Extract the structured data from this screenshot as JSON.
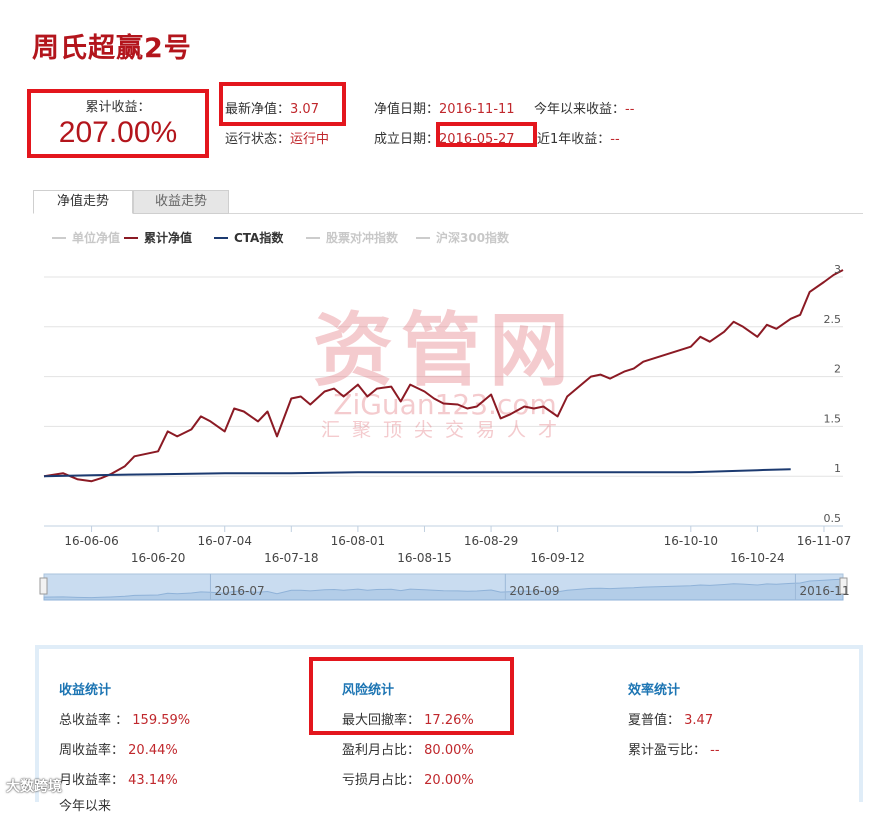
{
  "page": {
    "title": "周氏超赢2号"
  },
  "summary": {
    "cum_return_label": "累计收益：",
    "cum_return_value": "207.00%",
    "latest_nav_label": "最新净值：",
    "latest_nav_value": "3.07",
    "nav_date_label": "净值日期：",
    "nav_date_value": "2016-11-11",
    "ytd_label": "今年以来收益：",
    "ytd_value": "--",
    "status_label": "运行状态：",
    "status_value": "运行中",
    "inception_label": "成立日期：",
    "inception_value": "2016-05-27",
    "one_year_label": "近1年收益：",
    "one_year_value": "--"
  },
  "tabs": [
    {
      "label": "净值走势",
      "active": true
    },
    {
      "label": "收益走势",
      "active": false
    }
  ],
  "legend": [
    {
      "label": "单位净值",
      "color": "#cccccc",
      "enabled": false
    },
    {
      "label": "累计净值",
      "color": "#8b1a24",
      "enabled": true
    },
    {
      "label": "CTA指数",
      "color": "#1c3a70",
      "enabled": true
    },
    {
      "label": "股票对冲指数",
      "color": "#cccccc",
      "enabled": false
    },
    {
      "label": "沪深300指数",
      "color": "#cccccc",
      "enabled": false
    }
  ],
  "watermark": {
    "main": "资管网",
    "domain": "ZiGuan123.com",
    "slogan": "汇聚顶尖交易人才"
  },
  "navigator": {
    "labels": [
      "2016-07",
      "2016-09",
      "2016-11"
    ]
  },
  "chart_data": {
    "type": "line",
    "title": "",
    "xlabel": "",
    "ylabel": "",
    "ylim": [
      0.5,
      3.0
    ],
    "yticks": [
      "0.5",
      "1",
      "1.5",
      "2",
      "2.5",
      "3"
    ],
    "xticks": [
      "16-06-06",
      "16-06-20",
      "16-07-04",
      "16-07-18",
      "16-08-01",
      "16-08-15",
      "16-08-29",
      "16-09-12",
      "16-10-10",
      "16-10-24",
      "16-11-07"
    ],
    "grid": true,
    "legend_position": "top-left",
    "series": [
      {
        "name": "累计净值",
        "color": "#8b1a24",
        "x": [
          "2016-05-27",
          "2016-05-31",
          "2016-06-03",
          "2016-06-06",
          "2016-06-08",
          "2016-06-10",
          "2016-06-13",
          "2016-06-15",
          "2016-06-17",
          "2016-06-20",
          "2016-06-22",
          "2016-06-24",
          "2016-06-27",
          "2016-06-29",
          "2016-07-01",
          "2016-07-04",
          "2016-07-06",
          "2016-07-08",
          "2016-07-11",
          "2016-07-13",
          "2016-07-15",
          "2016-07-18",
          "2016-07-20",
          "2016-07-22",
          "2016-07-25",
          "2016-07-27",
          "2016-07-29",
          "2016-08-01",
          "2016-08-03",
          "2016-08-05",
          "2016-08-08",
          "2016-08-10",
          "2016-08-12",
          "2016-08-15",
          "2016-08-17",
          "2016-08-19",
          "2016-08-22",
          "2016-08-24",
          "2016-08-26",
          "2016-08-29",
          "2016-08-31",
          "2016-09-02",
          "2016-09-05",
          "2016-09-07",
          "2016-09-09",
          "2016-09-12",
          "2016-09-14",
          "2016-09-19",
          "2016-09-21",
          "2016-09-23",
          "2016-09-26",
          "2016-09-28",
          "2016-09-30",
          "2016-10-10",
          "2016-10-12",
          "2016-10-14",
          "2016-10-17",
          "2016-10-19",
          "2016-10-21",
          "2016-10-24",
          "2016-10-26",
          "2016-10-28",
          "2016-10-31",
          "2016-11-02",
          "2016-11-04",
          "2016-11-07",
          "2016-11-09",
          "2016-11-11"
        ],
        "y": [
          1.0,
          1.03,
          0.97,
          0.95,
          0.98,
          1.02,
          1.1,
          1.2,
          1.22,
          1.25,
          1.45,
          1.4,
          1.47,
          1.6,
          1.55,
          1.45,
          1.68,
          1.65,
          1.55,
          1.65,
          1.4,
          1.78,
          1.8,
          1.72,
          1.85,
          1.88,
          1.8,
          1.92,
          1.8,
          1.88,
          1.9,
          1.75,
          1.92,
          1.85,
          1.78,
          1.73,
          1.72,
          1.68,
          1.7,
          1.82,
          1.58,
          1.62,
          1.7,
          1.68,
          1.7,
          1.6,
          1.8,
          2.0,
          2.02,
          1.98,
          2.05,
          2.08,
          2.15,
          2.3,
          2.4,
          2.35,
          2.45,
          2.55,
          2.5,
          2.4,
          2.52,
          2.48,
          2.58,
          2.62,
          2.85,
          2.95,
          3.02,
          3.07
        ]
      },
      {
        "name": "CTA指数",
        "color": "#1c3a70",
        "x": [
          "2016-05-27",
          "2016-06-06",
          "2016-06-20",
          "2016-07-04",
          "2016-07-18",
          "2016-08-01",
          "2016-08-15",
          "2016-08-29",
          "2016-09-12",
          "2016-09-26",
          "2016-10-10",
          "2016-10-17",
          "2016-10-24",
          "2016-10-31"
        ],
        "y": [
          1.0,
          1.01,
          1.02,
          1.03,
          1.03,
          1.04,
          1.04,
          1.04,
          1.04,
          1.04,
          1.04,
          1.05,
          1.06,
          1.07
        ]
      }
    ]
  },
  "stats": {
    "return": {
      "title": "收益统计",
      "rows": [
        {
          "label": "总收益率 ：",
          "value": "159.59%"
        },
        {
          "label": "周收益率：",
          "value": "20.44%"
        },
        {
          "label": "月收益率：",
          "value": "43.14%"
        },
        {
          "label": "今年以来",
          "value": ""
        }
      ]
    },
    "risk": {
      "title": "风险统计",
      "rows": [
        {
          "label": "最大回撤率：",
          "value": "17.26%"
        },
        {
          "label": "盈利月占比：",
          "value": "80.00%"
        },
        {
          "label": "亏损月占比：",
          "value": "20.00%"
        }
      ]
    },
    "efficiency": {
      "title": "效率统计",
      "rows": [
        {
          "label": "夏普值：",
          "value": "3.47"
        },
        {
          "label": "累计盈亏比：",
          "value": "--"
        }
      ]
    }
  },
  "footer_watermark": "大数跨境"
}
